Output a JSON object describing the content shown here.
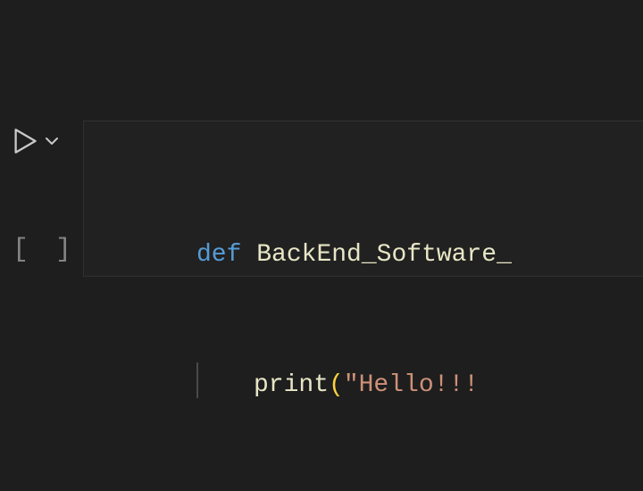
{
  "gutter": {
    "exec_indicator": "[ ]"
  },
  "code": {
    "line1": {
      "kw": "def",
      "space": " ",
      "fn": "BackEnd_Software_"
    },
    "line2": {
      "call": "print",
      "lparen": "(",
      "str": "\"Hello!!! "
    }
  },
  "icons": {
    "run": "run-triangle-icon",
    "chevron": "chevron-down-icon"
  },
  "colors": {
    "bg": "#1e1e1e",
    "cell_bg": "#212121",
    "cell_border": "#313131",
    "keyword": "#569cd6",
    "identifier": "#e8e6c6",
    "paren": "#ffd23f",
    "string": "#ce9178",
    "gutter_icon": "#c9c9c9",
    "bracket_text": "#848484"
  }
}
